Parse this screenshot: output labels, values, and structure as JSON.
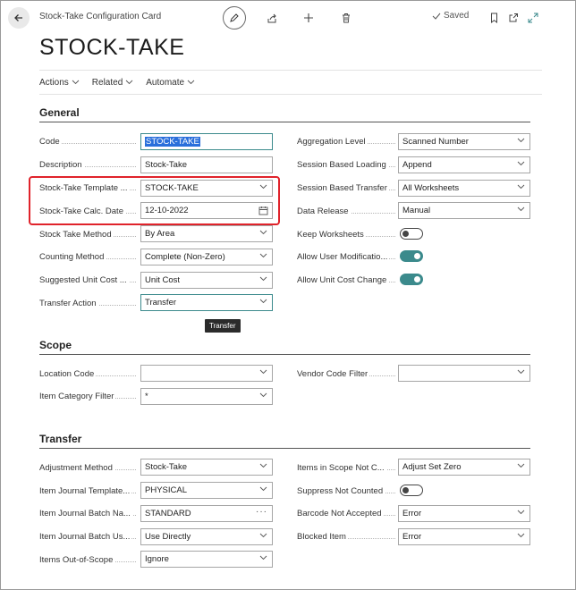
{
  "header": {
    "caption": "Stock-Take Configuration Card",
    "title": "STOCK-TAKE",
    "saved_label": "Saved"
  },
  "actions": [
    {
      "label": "Actions"
    },
    {
      "label": "Related"
    },
    {
      "label": "Automate"
    }
  ],
  "general": {
    "title": "General",
    "left": {
      "code": {
        "label": "Code",
        "value": "STOCK-TAKE"
      },
      "description": {
        "label": "Description",
        "value": "Stock-Take"
      },
      "template": {
        "label": "Stock-Take Template ...",
        "value": "STOCK-TAKE"
      },
      "calc_date": {
        "label": "Stock-Take Calc. Date",
        "value": "12-10-2022"
      },
      "method": {
        "label": "Stock Take Method",
        "value": "By Area"
      },
      "counting": {
        "label": "Counting Method",
        "value": "Complete (Non-Zero)"
      },
      "unit_cost": {
        "label": "Suggested Unit Cost ...",
        "value": "Unit Cost"
      },
      "transfer_action": {
        "label": "Transfer Action",
        "value": "Transfer"
      }
    },
    "right": {
      "aggregation": {
        "label": "Aggregation Level",
        "value": "Scanned Number"
      },
      "session_loading": {
        "label": "Session Based Loading",
        "value": "Append"
      },
      "session_transfer": {
        "label": "Session Based Transfer",
        "value": "All Worksheets"
      },
      "data_release": {
        "label": "Data Release",
        "value": "Manual"
      },
      "keep_ws": {
        "label": "Keep Worksheets",
        "on": false
      },
      "allow_mod": {
        "label": "Allow User Modificatio...",
        "on": true
      },
      "allow_cost": {
        "label": "Allow Unit Cost Change",
        "on": true
      }
    }
  },
  "tooltip": "Transfer",
  "scope": {
    "title": "Scope",
    "location": {
      "label": "Location Code",
      "value": ""
    },
    "item_category": {
      "label": "Item Category Filter",
      "value": "*"
    },
    "vendor": {
      "label": "Vendor Code Filter",
      "value": ""
    }
  },
  "transfer": {
    "title": "Transfer",
    "left": {
      "adjustment": {
        "label": "Adjustment Method",
        "value": "Stock-Take"
      },
      "journal_template": {
        "label": "Item Journal Template...",
        "value": "PHYSICAL"
      },
      "batch_name": {
        "label": "Item Journal Batch Na...",
        "value": "STANDARD"
      },
      "batch_usage": {
        "label": "Item Journal Batch Us...",
        "value": "Use Directly"
      },
      "out_of_scope": {
        "label": "Items Out-of-Scope",
        "value": "Ignore"
      }
    },
    "right": {
      "in_scope": {
        "label": "Items in Scope Not C...",
        "value": "Adjust Set Zero"
      },
      "suppress": {
        "label": "Suppress Not Counted",
        "on": false
      },
      "barcode": {
        "label": "Barcode Not Accepted",
        "value": "Error"
      },
      "blocked": {
        "label": "Blocked Item",
        "value": "Error"
      }
    }
  },
  "colors": {
    "accent": "#3b8a8c",
    "highlight": "#e0232b",
    "selection": "#2a6fdb"
  }
}
